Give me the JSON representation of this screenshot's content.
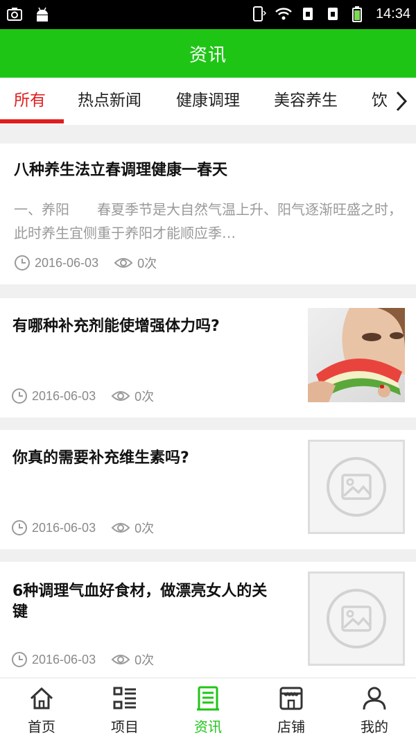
{
  "status_bar": {
    "time": "14:34"
  },
  "header": {
    "title": "资讯"
  },
  "tabs": [
    {
      "label": "所有",
      "active": true
    },
    {
      "label": "热点新闻",
      "active": false
    },
    {
      "label": "健康调理",
      "active": false
    },
    {
      "label": "美容养生",
      "active": false
    },
    {
      "label": "饮",
      "active": false
    }
  ],
  "articles": [
    {
      "title": "八种养生法立春调理健康一春天",
      "summary": "一、养阳　　春夏季节是大自然气温上升、阳气逐渐旺盛之时，此时养生宜侧重于养阳才能顺应季…",
      "date": "2016-06-03",
      "views": "0次",
      "thumbnail": "none"
    },
    {
      "title": "有哪种补充剂能使增强体力吗?",
      "date": "2016-06-03",
      "views": "0次",
      "thumbnail": "photo-woman-watermelon"
    },
    {
      "title": "你真的需要补充维生素吗?",
      "date": "2016-06-03",
      "views": "0次",
      "thumbnail": "image-placeholder-icon"
    },
    {
      "title": "6种调理气血好食材，做漂亮女人的关键",
      "date": "2016-06-03",
      "views": "0次",
      "thumbnail": "image-placeholder-icon"
    }
  ],
  "bottom_nav": [
    {
      "label": "首页",
      "icon": "home-icon",
      "active": false
    },
    {
      "label": "项目",
      "icon": "list-icon",
      "active": false
    },
    {
      "label": "资讯",
      "icon": "news-icon",
      "active": true
    },
    {
      "label": "店铺",
      "icon": "store-icon",
      "active": false
    },
    {
      "label": "我的",
      "icon": "user-icon",
      "active": false
    }
  ],
  "colors": {
    "brand_green": "#1fc515",
    "active_tab_red": "#e01d1d",
    "meta_gray": "#8a8a8a",
    "page_background": "#f0f0f0"
  }
}
